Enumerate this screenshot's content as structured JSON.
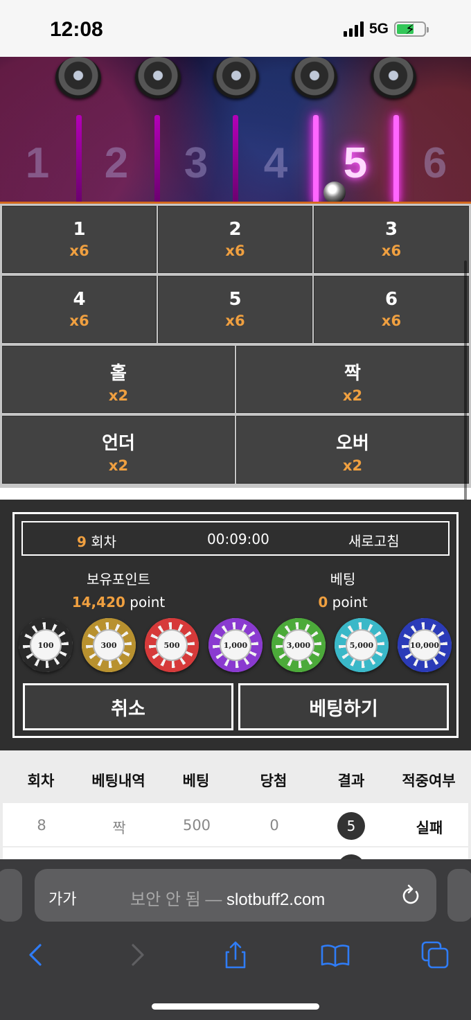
{
  "status_bar": {
    "time": "12:08",
    "network": "5G"
  },
  "game_board": {
    "slots": [
      "1",
      "2",
      "3",
      "4",
      "5",
      "6"
    ],
    "active_slot": "5"
  },
  "bet_options": [
    {
      "label": "1",
      "multiplier": "x6"
    },
    {
      "label": "2",
      "multiplier": "x6"
    },
    {
      "label": "3",
      "multiplier": "x6"
    },
    {
      "label": "4",
      "multiplier": "x6"
    },
    {
      "label": "5",
      "multiplier": "x6"
    },
    {
      "label": "6",
      "multiplier": "x6"
    },
    {
      "label": "홀",
      "multiplier": "x2"
    },
    {
      "label": "짝",
      "multiplier": "x2"
    },
    {
      "label": "언더",
      "multiplier": "x2"
    },
    {
      "label": "오버",
      "multiplier": "x2"
    }
  ],
  "panel": {
    "round_number": "9",
    "round_suffix": " 회차",
    "timer": "00:09:00",
    "refresh_label": "새로고침",
    "points_label": "보유포인트",
    "points_value": "14,420",
    "points_unit": " point",
    "bet_label": "베팅",
    "bet_value": "0",
    "bet_unit": " point",
    "chips": [
      {
        "value": "100",
        "color": "#2a2a2a"
      },
      {
        "value": "300",
        "color": "#b8912f"
      },
      {
        "value": "500",
        "color": "#d63a3a"
      },
      {
        "value": "1,000",
        "color": "#8a3ad0"
      },
      {
        "value": "3,000",
        "color": "#4caa3a"
      },
      {
        "value": "5,000",
        "color": "#3ab8c8"
      },
      {
        "value": "10,000",
        "color": "#2b3bb8"
      }
    ],
    "cancel_label": "취소",
    "place_bet_label": "베팅하기"
  },
  "history": {
    "headers": [
      "회차",
      "베팅내역",
      "베팅",
      "당첨",
      "결과",
      "적중여부"
    ],
    "rows": [
      {
        "round": "8",
        "bet_detail": "짝",
        "bet": "500",
        "win": "0",
        "result": "5",
        "hit": "실패"
      }
    ]
  },
  "browser": {
    "text_size_label": "가가",
    "security_label": "보안 안 됨 — ",
    "domain": "slotbuff2.com"
  }
}
